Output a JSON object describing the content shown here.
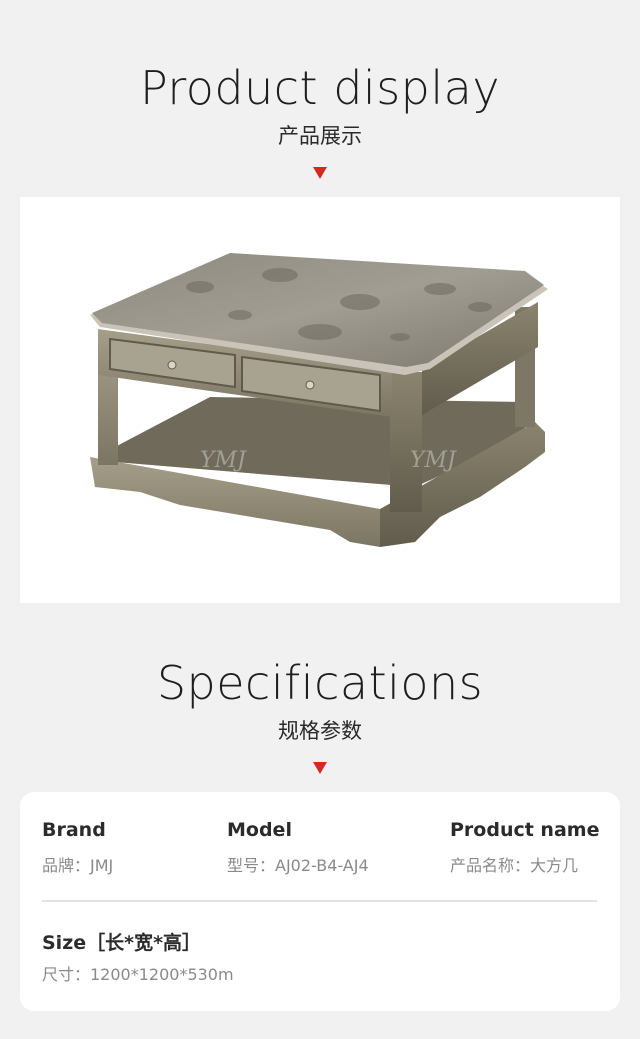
{
  "display": {
    "title": "Product display",
    "subtitle": "产品展示"
  },
  "photo": {
    "watermark": "YMJ",
    "icon": "coffee-table-photo"
  },
  "specs": {
    "title": "Specifications",
    "subtitle": "规格参数",
    "brand": {
      "label": "Brand",
      "value": "品牌：JMJ"
    },
    "model": {
      "label": "Model",
      "value": "型号：AJ02-B4-AJ4"
    },
    "product_name": {
      "label": "Product name",
      "value": "产品名称：大方几"
    },
    "size": {
      "label": "Size［长*宽*高］",
      "value": "尺寸：1200*1200*530m"
    }
  },
  "colors": {
    "accent": "#d42a1c",
    "background": "#f1f1f1",
    "card": "#ffffff"
  }
}
